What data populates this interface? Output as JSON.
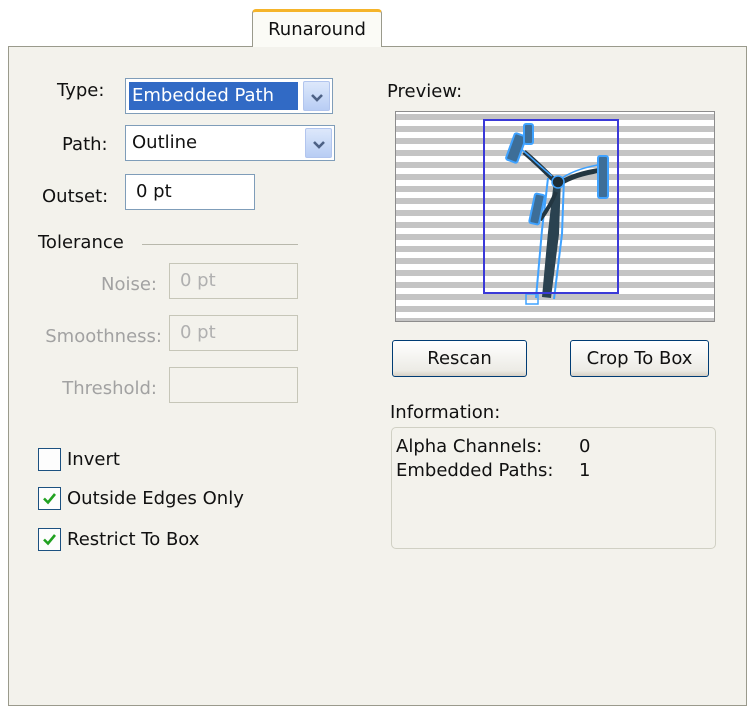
{
  "tab": {
    "label": "Runaround"
  },
  "form": {
    "type": {
      "label": "Type:",
      "value": "Embedded Path"
    },
    "path": {
      "label": "Path:",
      "value": "Outline"
    },
    "outset": {
      "label": "Outset:",
      "value": "0 pt"
    },
    "tolerance": {
      "heading": "Tolerance",
      "noise": {
        "label": "Noise:",
        "value": "0 pt"
      },
      "smoothness": {
        "label": "Smoothness:",
        "value": "0 pt"
      },
      "threshold": {
        "label": "Threshold:",
        "value": ""
      }
    },
    "checkboxes": [
      {
        "label": "Invert",
        "checked": false
      },
      {
        "label": "Outside Edges Only",
        "checked": true
      },
      {
        "label": "Restrict To Box",
        "checked": true
      }
    ]
  },
  "preview": {
    "label": "Preview:",
    "stripe_color": "#c4c4c4",
    "box_color": "#3a39d8",
    "outline_color": "#3fa2ff"
  },
  "buttons": {
    "rescan": "Rescan",
    "crop": "Crop To Box"
  },
  "information": {
    "label": "Information:",
    "rows": [
      {
        "key": "Alpha Channels:",
        "value": "0"
      },
      {
        "key": "Embedded Paths:",
        "value": "1"
      }
    ]
  },
  "colors": {
    "accent_tab": "#f5b42a",
    "selection": "#316ac5",
    "check": "#21a121"
  }
}
